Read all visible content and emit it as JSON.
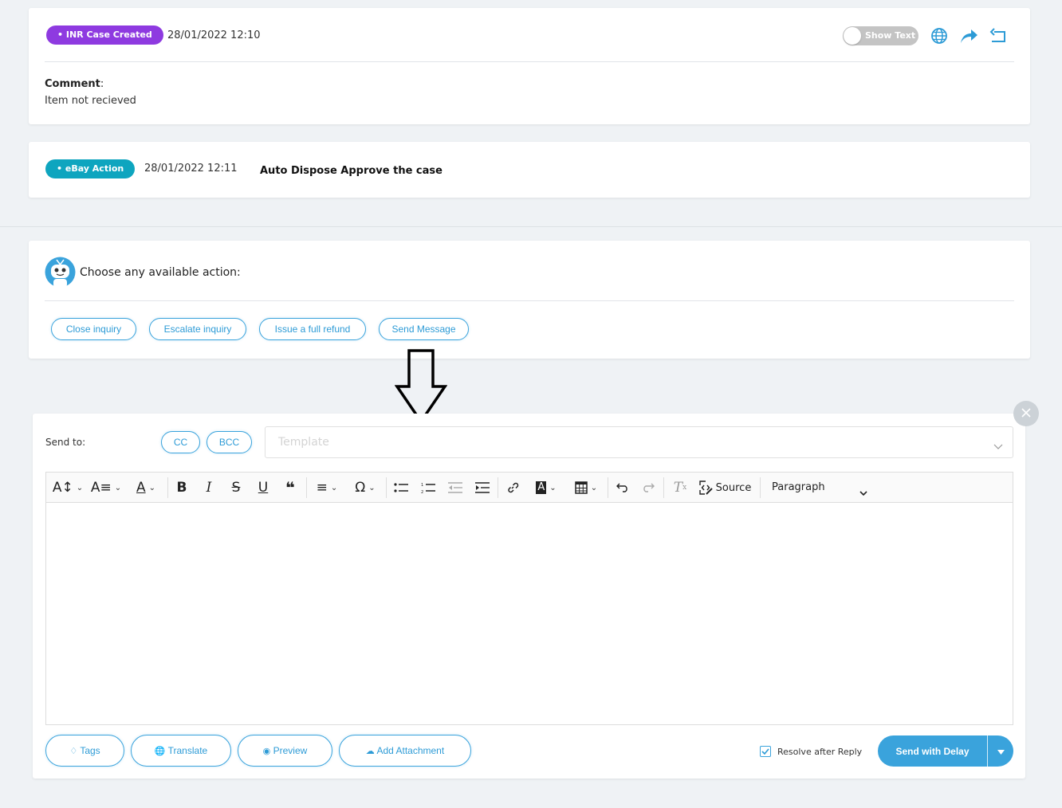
{
  "timeline": [
    {
      "badge": "• INR Case Created",
      "badge_color": "#8e3ae0",
      "timestamp": "28/01/2022 12:10",
      "comment_label": "Comment",
      "comment_colon": ":",
      "comment_text": "Item not recieved",
      "toggle_label": "Show Text"
    },
    {
      "badge": "• eBay Action",
      "badge_color": "#0ea5bf",
      "timestamp": "28/01/2022 12:11",
      "description": "Auto Dispose Approve the case"
    }
  ],
  "bot": {
    "prompt": "Choose any available action:",
    "actions": [
      "Close inquiry",
      "Escalate inquiry",
      "Issue a full refund",
      "Send Message"
    ]
  },
  "composer": {
    "send_to_label": "Send to:",
    "cc_label": "CC",
    "bcc_label": "BCC",
    "template_placeholder": "Template",
    "toolbar": {
      "source_label": "Source",
      "paragraph_label": "Paragraph"
    },
    "footer": {
      "tags_label": "Tags",
      "translate_label": "Translate",
      "preview_label": "Preview",
      "attachment_label": "Add Attachment",
      "resolve_label": "Resolve after Reply",
      "resolve_checked": true,
      "send_label": "Send with Delay"
    }
  },
  "colors": {
    "accent": "#3aa3dc",
    "background": "#eff2f5"
  }
}
